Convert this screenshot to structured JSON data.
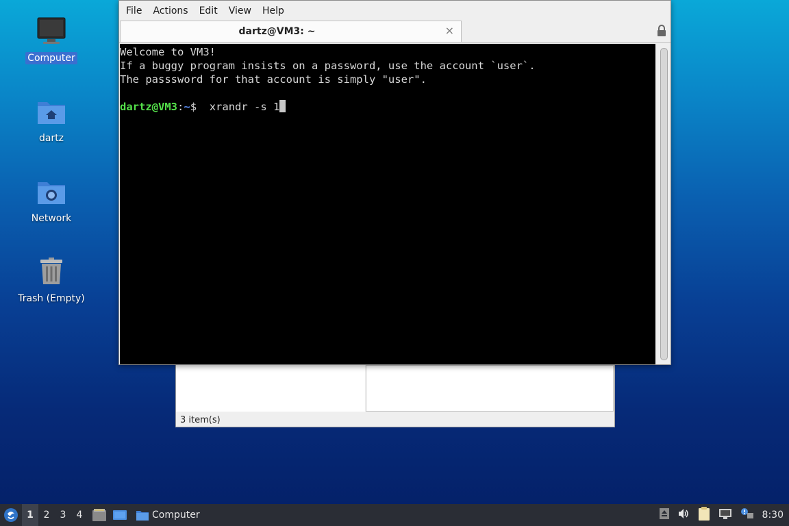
{
  "desktop": {
    "icons": [
      {
        "label": "Computer"
      },
      {
        "label": "dartz"
      },
      {
        "label": "Network"
      },
      {
        "label": "Trash (Empty)"
      }
    ]
  },
  "file_manager": {
    "status": "3 item(s)"
  },
  "terminal": {
    "menu": [
      "File",
      "Actions",
      "Edit",
      "View",
      "Help"
    ],
    "tab_title": "dartz@VM3: ~",
    "tab_close": "×",
    "lines": [
      "Welcome to VM3!",
      "If a buggy program insists on a password, use the account `user`.",
      "The passsword for that account is simply \"user\"."
    ],
    "prompt": {
      "user_host": "dartz@VM3",
      "colon": ":",
      "path": "~",
      "dollar": "$",
      "command": "  xrandr -s 1"
    }
  },
  "taskbar": {
    "workspaces": [
      "1",
      "2",
      "3",
      "4"
    ],
    "active_workspace": "1",
    "task_label": "Computer",
    "clock": "8:30"
  }
}
